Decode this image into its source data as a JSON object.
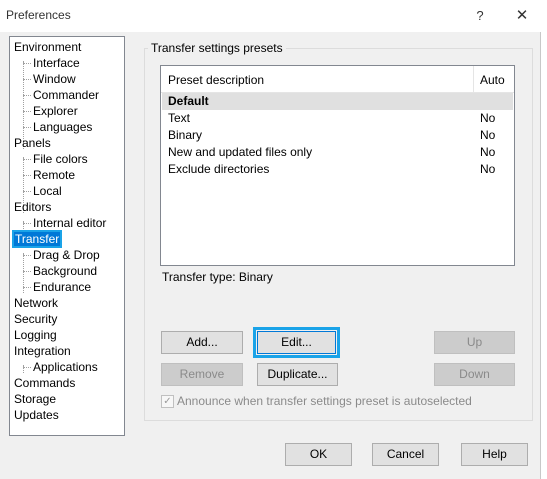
{
  "window": {
    "title": "Preferences",
    "help_glyph": "?",
    "close_glyph": "✕"
  },
  "tree": {
    "items": [
      {
        "label": "Environment",
        "level": 0
      },
      {
        "label": "Interface",
        "level": 1
      },
      {
        "label": "Window",
        "level": 1
      },
      {
        "label": "Commander",
        "level": 1
      },
      {
        "label": "Explorer",
        "level": 1
      },
      {
        "label": "Languages",
        "level": 1
      },
      {
        "label": "Panels",
        "level": 0
      },
      {
        "label": "File colors",
        "level": 1
      },
      {
        "label": "Remote",
        "level": 1
      },
      {
        "label": "Local",
        "level": 1
      },
      {
        "label": "Editors",
        "level": 0
      },
      {
        "label": "Internal editor",
        "level": 1
      },
      {
        "label": "Transfer",
        "level": 0,
        "selected": true
      },
      {
        "label": "Drag & Drop",
        "level": 1
      },
      {
        "label": "Background",
        "level": 1
      },
      {
        "label": "Endurance",
        "level": 1
      },
      {
        "label": "Network",
        "level": 0
      },
      {
        "label": "Security",
        "level": 0
      },
      {
        "label": "Logging",
        "level": 0
      },
      {
        "label": "Integration",
        "level": 0
      },
      {
        "label": "Applications",
        "level": 1
      },
      {
        "label": "Commands",
        "level": 0
      },
      {
        "label": "Storage",
        "level": 0
      },
      {
        "label": "Updates",
        "level": 0
      }
    ]
  },
  "presets": {
    "group_title": "Transfer settings presets",
    "columns": [
      "Preset description",
      "Auto"
    ],
    "rows": [
      {
        "description": "Default",
        "auto": ""
      },
      {
        "description": "Text",
        "auto": "No"
      },
      {
        "description": "Binary",
        "auto": "No"
      },
      {
        "description": "New and updated files only",
        "auto": "No"
      },
      {
        "description": "Exclude directories",
        "auto": "No"
      }
    ],
    "transfer_type": "Transfer type: Binary",
    "buttons": {
      "add": "Add...",
      "edit": "Edit...",
      "up": "Up",
      "remove": "Remove",
      "duplicate": "Duplicate...",
      "down": "Down"
    },
    "announce_label": "Announce when transfer settings preset is autoselected",
    "announce_checked": true
  },
  "footer": {
    "ok": "OK",
    "cancel": "Cancel",
    "help": "Help"
  },
  "colors": {
    "selection": "#0078d7",
    "focus_outline": "#1aa3e8",
    "default_row": "#e0e0e0"
  }
}
